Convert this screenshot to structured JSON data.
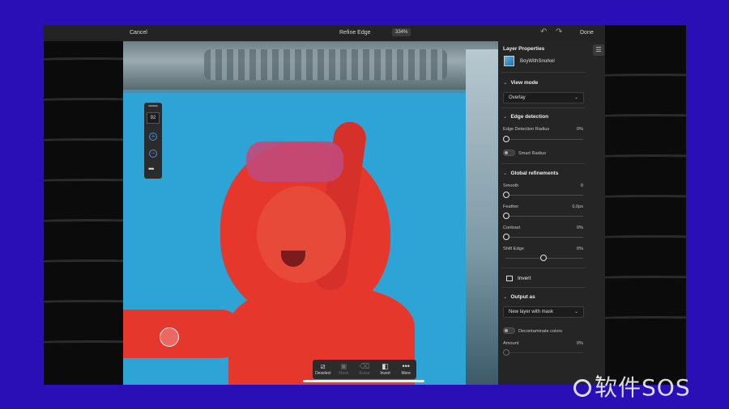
{
  "topbar": {
    "cancel_label": "Cancel",
    "title": "Refine Edge",
    "zoom": "334%",
    "done_label": "Done"
  },
  "brush_tool": {
    "size": "92"
  },
  "toolbar": {
    "items": [
      {
        "label": "Deselect",
        "icon": "deselect-icon",
        "enabled": true
      },
      {
        "label": "Mask",
        "icon": "mask-icon",
        "enabled": false
      },
      {
        "label": "Erase",
        "icon": "eraser-icon",
        "enabled": false
      },
      {
        "label": "Invert",
        "icon": "invert-icon",
        "enabled": true
      },
      {
        "label": "More",
        "icon": "more-icon",
        "enabled": true
      }
    ]
  },
  "panel": {
    "title": "Layer Properties",
    "layer_name": "BoyWithSnorkel",
    "view_mode": {
      "heading": "View mode",
      "value": "Overlay"
    },
    "edge_detection": {
      "heading": "Edge detection",
      "radius_label": "Edge Detection Radius",
      "radius_value": "0%",
      "smart_radius_label": "Smart Radius"
    },
    "global_refinements": {
      "heading": "Global refinements",
      "smooth_label": "Smooth",
      "smooth_value": "0",
      "feather_label": "Feather",
      "feather_value": "0.0px",
      "contrast_label": "Contrast",
      "contrast_value": "0%",
      "shift_label": "Shift Edge",
      "shift_value": "0%"
    },
    "invert_label": "Invert",
    "output": {
      "heading": "Output as",
      "value": "New layer with mask",
      "decontaminate_label": "Decontaminate colors",
      "amount_label": "Amount",
      "amount_value": "0%"
    }
  },
  "watermark": {
    "text": "软件SOS"
  }
}
